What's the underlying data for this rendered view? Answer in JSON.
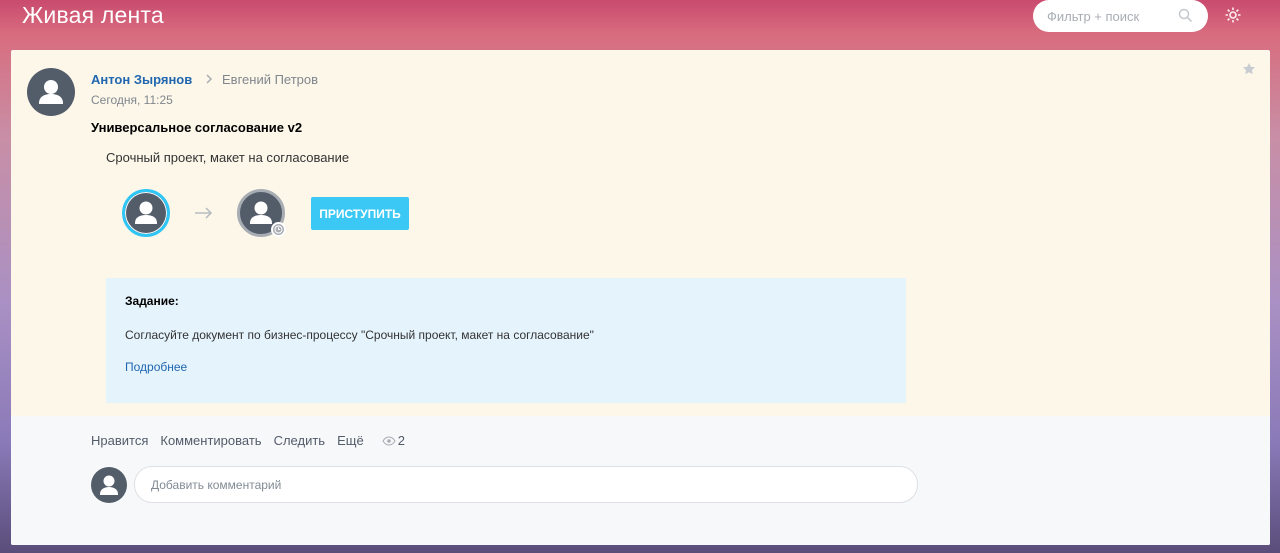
{
  "header": {
    "title": "Живая лента",
    "search_placeholder": "Фильтр + поиск"
  },
  "post": {
    "author": "Антон Зырянов",
    "recipient": "Евгений Петров",
    "date": "Сегодня, 11:25",
    "title": "Универсальное согласование v2",
    "text": "Срочный проект, макет на согласование",
    "start_button": "ПРИСТУПИТЬ",
    "task": {
      "heading": "Задание:",
      "text": "Согласуйте документ по бизнес-процессу \"Срочный проект, макет на согласование\"",
      "more_link": "Подробнее"
    },
    "actions": {
      "like": "Нравится",
      "comment": "Комментировать",
      "follow": "Следить",
      "more": "Ещё",
      "views": "2"
    },
    "comment_placeholder": "Добавить комментарий"
  },
  "colors": {
    "accent": "#3bc8f5",
    "link": "#2067b0",
    "active_ring": "#2fc6f6",
    "pending_ring": "#a8adb4",
    "card_bg": "#fcf7e9",
    "task_bg": "#e5f3fc"
  },
  "icons": [
    "search-icon",
    "settings-icon",
    "star-icon",
    "chevron-right-icon",
    "arrow-right-icon",
    "clock-icon",
    "eye-icon",
    "user-avatar-icon"
  ]
}
